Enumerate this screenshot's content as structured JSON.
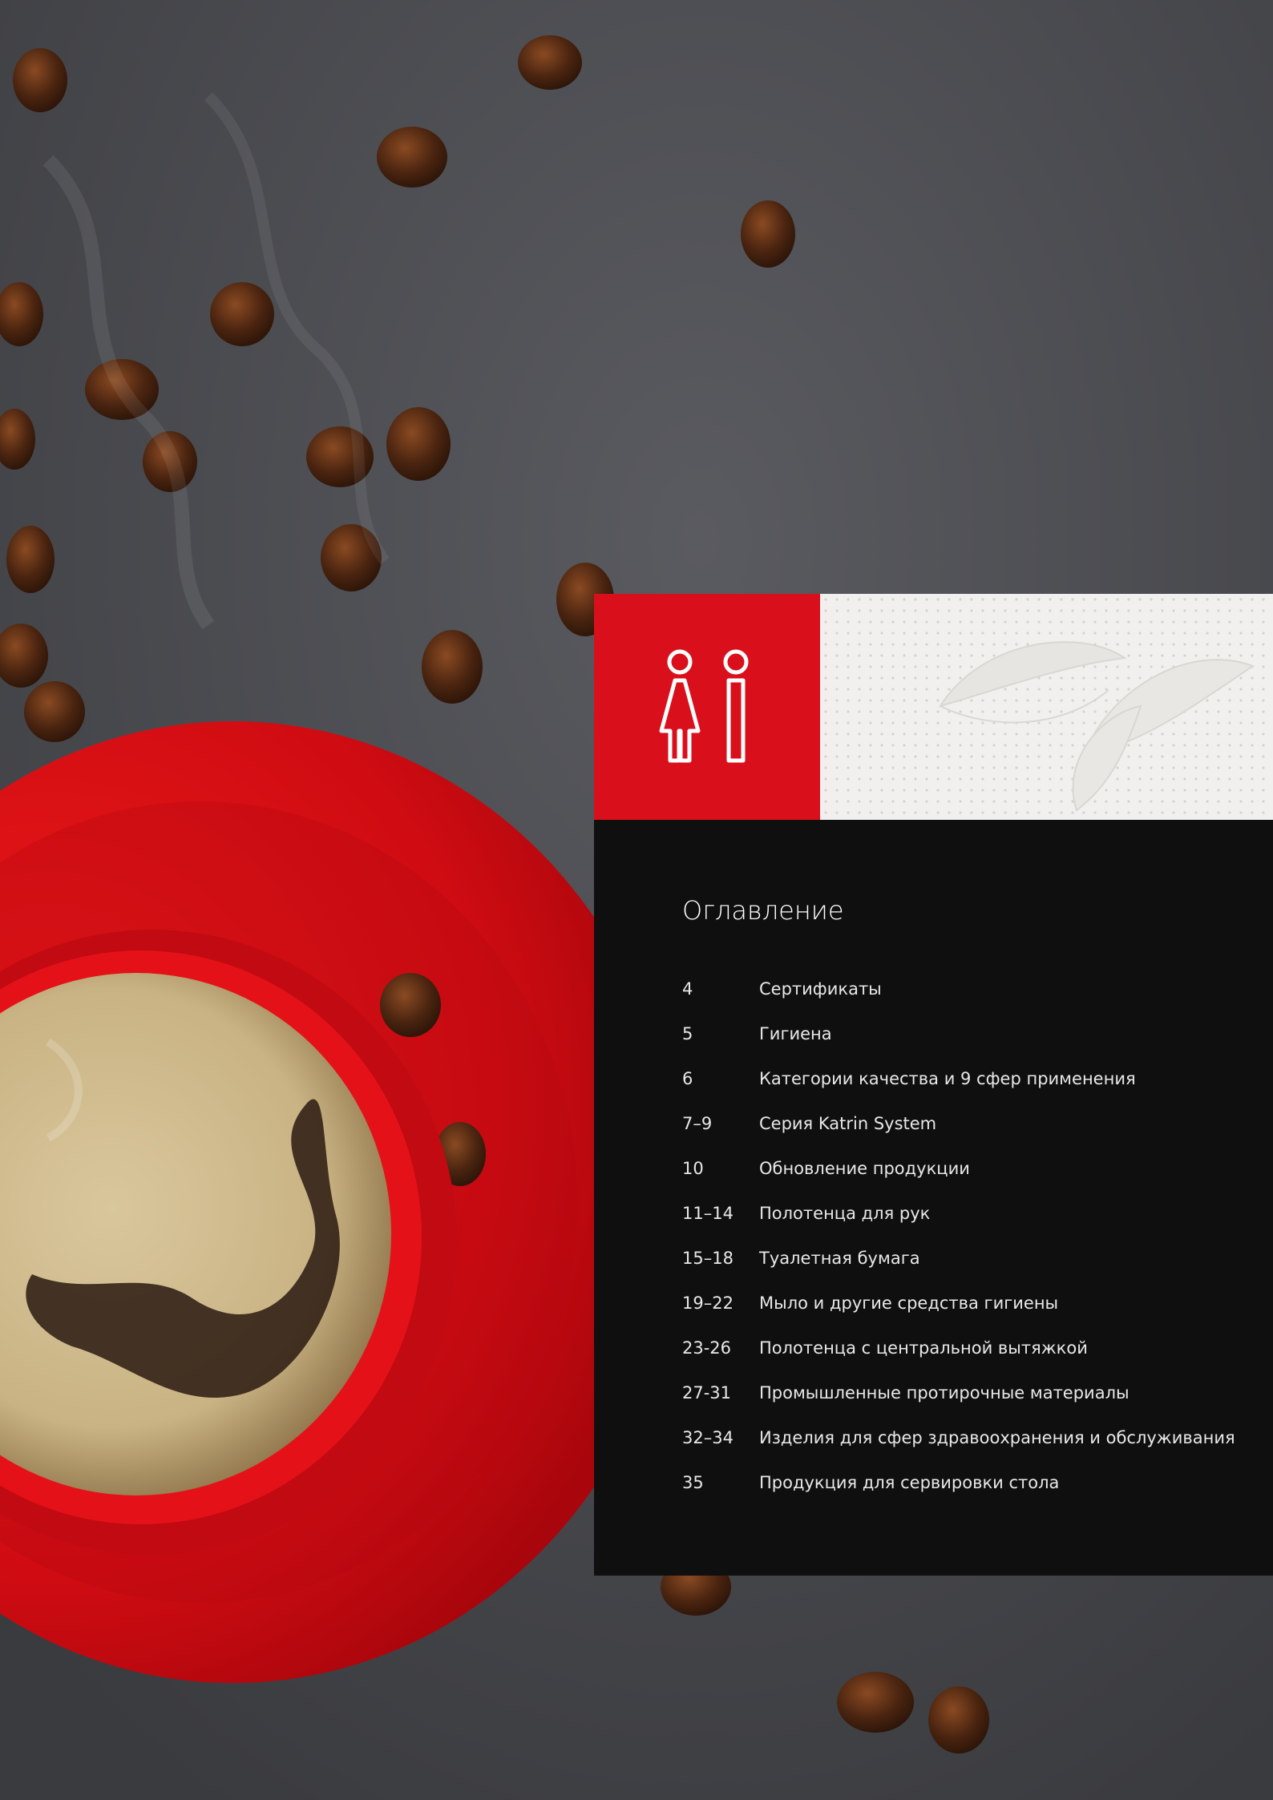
{
  "icons": {
    "restroom": "restroom-icon",
    "background": "coffee-cup-photo",
    "texture": "embossed-paper-texture"
  },
  "colors": {
    "accent_red": "#d9101c",
    "panel_dark": "#0f0f10",
    "paper_white": "#f1f0ee",
    "slate": "#4a4b4f",
    "text_light": "#e8e8e8"
  },
  "toc": {
    "title": "Оглавление",
    "items": [
      {
        "pages": "4",
        "label": "Сертификаты"
      },
      {
        "pages": "5",
        "label": "Гигиена"
      },
      {
        "pages": "6",
        "label": "Категории качества и 9 сфер применения"
      },
      {
        "pages": "7–9",
        "label": "Серия Katrin System"
      },
      {
        "pages": "10",
        "label": "Обновление продукции"
      },
      {
        "pages": "11–14",
        "label": "Полотенца для рук"
      },
      {
        "pages": "15–18",
        "label": "Туалетная бумага"
      },
      {
        "pages": "19–22",
        "label": "Мыло и другие средства гигиены"
      },
      {
        "pages": "23-26",
        "label": "Полотенца с центральной вытяжкой"
      },
      {
        "pages": "27-31",
        "label": "Промышленные протирочные материалы"
      },
      {
        "pages": "32–34",
        "label": "Изделия для сфер здравоохранения и обслуживания"
      },
      {
        "pages": "35",
        "label": "Продукция для сервировки стола"
      }
    ]
  }
}
